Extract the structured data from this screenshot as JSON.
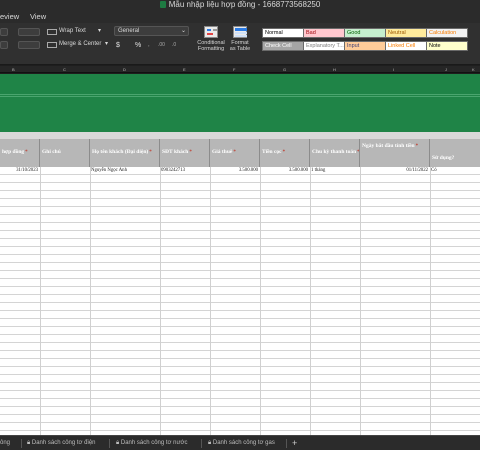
{
  "window": {
    "title": "Mẫu nhập liệu hợp đồng - 1668773568250"
  },
  "menu": {
    "tabs": [
      "eview",
      "View"
    ]
  },
  "ribbon": {
    "wrap_text": "Wrap Text",
    "merge_center": "Merge & Center",
    "number_format": "General",
    "currency_symbol": "$",
    "percent_symbol": "%",
    "conditional_formatting": [
      "Conditional",
      "Formatting"
    ],
    "format_as_table": [
      "Format",
      "as Table"
    ],
    "cell_styles": [
      {
        "label": "Normal",
        "bg": "#ffffff",
        "fg": "#000000"
      },
      {
        "label": "Bad",
        "bg": "#ffc7ce",
        "fg": "#9c0006"
      },
      {
        "label": "Good",
        "bg": "#c6efce",
        "fg": "#006100"
      },
      {
        "label": "Neutral",
        "bg": "#ffeb9c",
        "fg": "#9c5700"
      },
      {
        "label": "Calculation",
        "bg": "#f2f2f2",
        "fg": "#fa7d00"
      },
      {
        "label": "Check Cell",
        "bg": "#a5a5a5",
        "fg": "#ffffff"
      },
      {
        "label": "Explanatory T...",
        "bg": "#ffffff",
        "fg": "#7f7f7f"
      },
      {
        "label": "Input",
        "bg": "#ffcc99",
        "fg": "#3f3f76"
      },
      {
        "label": "Linked Cell",
        "bg": "#ffffff",
        "fg": "#fa7d00"
      },
      {
        "label": "Note",
        "bg": "#ffffcc",
        "fg": "#000000"
      }
    ]
  },
  "columns": [
    "B",
    "C",
    "D",
    "E",
    "F",
    "G",
    "H",
    "I",
    "J",
    "K"
  ],
  "sheet": {
    "headers": [
      {
        "label": "hợp đồng",
        "mark": "*"
      },
      {
        "label": "Ghi chú",
        "mark": ""
      },
      {
        "label": "Họ tên khách (Đại diện)",
        "mark": "*"
      },
      {
        "label": "SĐT khách",
        "mark": "*"
      },
      {
        "label": "Giá thuê",
        "mark": "*"
      },
      {
        "label": "Tiền cọc",
        "mark": "*"
      },
      {
        "label": "Chu kỳ thanh toán",
        "mark": "*"
      },
      {
        "label": "Ngày bắt đầu tính tiền",
        "mark": "*"
      },
      {
        "label": "Sử dụng?",
        "mark": ""
      }
    ],
    "rows": [
      {
        "contract_date": "31/10/2023",
        "note": "",
        "customer_name": "Nguyễn Ngọc Anh",
        "phone": "0903242713",
        "rent": "3.500.000",
        "deposit": "3.500.000",
        "payment_cycle": "1 tháng",
        "start_date": "01/11/2022",
        "in_use": "Có"
      }
    ]
  },
  "tabs": [
    {
      "label": "ông"
    },
    {
      "label": "Danh sách công tơ điện"
    },
    {
      "label": "Danh sách công tơ nước"
    },
    {
      "label": "Danh sách công tơ gas"
    }
  ],
  "add_tab_symbol": "+",
  "colors": {
    "band_green": "#1f8447",
    "header_grey": "#b7b7b7"
  }
}
